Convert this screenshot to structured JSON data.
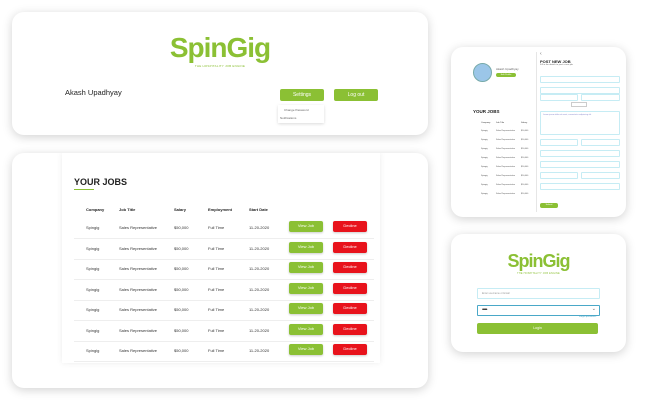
{
  "brand": {
    "logo": "SpinGig",
    "tagline": "THE HOSPITALITY JOB ENGINE",
    "color": "#8bc034"
  },
  "header": {
    "user_name": "Akash Upadhyay",
    "settings_label": "Settings",
    "logout_label": "Log out",
    "dropdown": [
      "Change Password",
      "Notifications"
    ]
  },
  "jobs": {
    "title": "YOUR JOBS",
    "columns": [
      "Company",
      "Job Title",
      "Salary",
      "Employment",
      "Start Date"
    ],
    "view_label": "View Job",
    "decline_label": "Decline",
    "rows": [
      {
        "company": "Spingig",
        "title": "Sales Representative",
        "salary": "$50,000",
        "employment": "Full Time",
        "date": "11-20-2020"
      },
      {
        "company": "Spingig",
        "title": "Sales Representative",
        "salary": "$50,000",
        "employment": "Full Time",
        "date": "11-20-2020"
      },
      {
        "company": "Spingig",
        "title": "Sales Representative",
        "salary": "$50,000",
        "employment": "Full Time",
        "date": "11-20-2020"
      },
      {
        "company": "Spingig",
        "title": "Sales Representative",
        "salary": "$50,000",
        "employment": "Full Time",
        "date": "11-20-2020"
      },
      {
        "company": "Spingig",
        "title": "Sales Representative",
        "salary": "$50,000",
        "employment": "Full Time",
        "date": "11-20-2020"
      },
      {
        "company": "Spingig",
        "title": "Sales Representative",
        "salary": "$50,000",
        "employment": "Full Time",
        "date": "11-20-2020"
      },
      {
        "company": "Spingig",
        "title": "Sales Representative",
        "salary": "$50,000",
        "employment": "Full Time",
        "date": "11-20-2020"
      }
    ]
  },
  "post_job": {
    "user_name": "Akash Upadhyay",
    "profile_button": "Edit Profile",
    "title": "POST NEW JOB",
    "subtitle": "Fill in the details to post a new job",
    "section_title": "YOUR JOBS",
    "desc_placeholder": "Lorem ipsum dolor sit amet, consectetur adipiscing elit",
    "submit": "Submit",
    "mini_columns": [
      "Company",
      "Job Title",
      "Salary"
    ],
    "mini_rows": [
      [
        "Spingig",
        "Sales Representative",
        "$50,000"
      ],
      [
        "Spingig",
        "Sales Representative",
        "$50,000"
      ],
      [
        "Spingig",
        "Sales Representative",
        "$50,000"
      ],
      [
        "Spingig",
        "Sales Representative",
        "$50,000"
      ],
      [
        "Spingig",
        "Sales Representative",
        "$50,000"
      ],
      [
        "Spingig",
        "Sales Representative",
        "$50,000"
      ],
      [
        "Spingig",
        "Sales Representative",
        "$50,000"
      ],
      [
        "Spingig",
        "Sales Representative",
        "$50,000"
      ]
    ]
  },
  "login": {
    "email_placeholder": "Enter username or Email",
    "password_mask": "••••••",
    "forgot": "Forgot password?",
    "login_label": "Login"
  }
}
